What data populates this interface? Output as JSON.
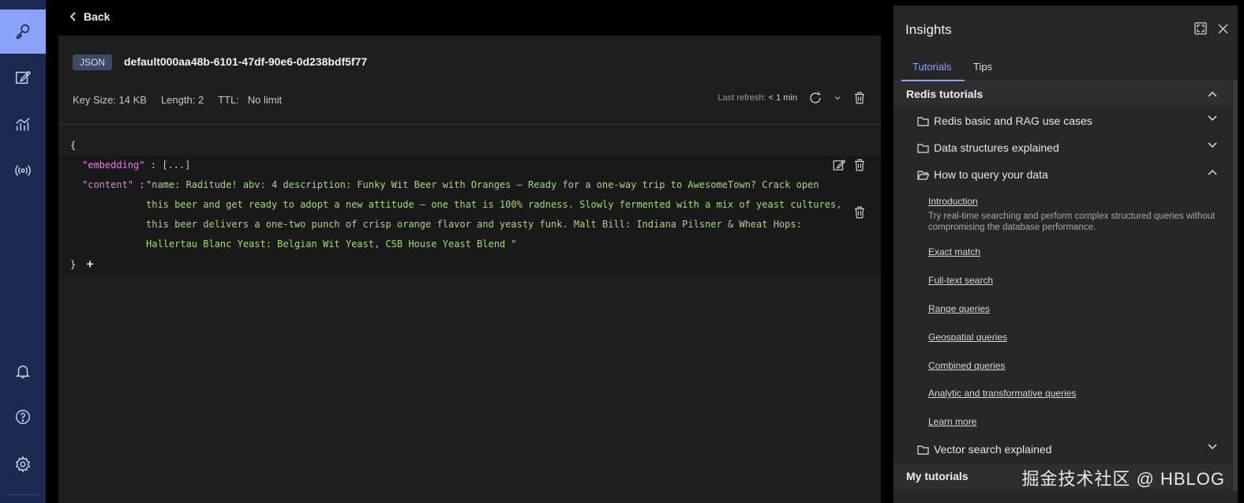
{
  "nav": {
    "items": [
      "browser-icon",
      "workbench-icon",
      "analytics-icon",
      "pubsub-icon"
    ],
    "bottom_items": [
      "notifications-icon",
      "help-icon",
      "settings-icon"
    ]
  },
  "topbar": {
    "back_label": "Back"
  },
  "key": {
    "type_badge": "JSON",
    "name": "default000aa48b-6101-47df-90e6-0d238bdf5f77",
    "key_size": "Key Size: 14 KB",
    "length": "Length: 2",
    "ttl_label": "TTL:",
    "ttl_value": "No limit",
    "last_refresh_label": "Last refresh:",
    "last_refresh_value": "< 1 min"
  },
  "json": {
    "open_brace": "{",
    "close_brace": "}",
    "embedding_key": "\"embedding\"",
    "embedding_value": "[...]",
    "colon": ":",
    "content_key": "\"content\"",
    "content_lines": [
      "\"name: Raditude! abv: 4 description: Funky Wit Beer with Oranges – Ready for a one-way trip to AwesomeTown? Crack open",
      "this beer and get ready to adopt a new attitude – one that is 100% radness. Slowly fermented with a mix of yeast cultures,",
      "this beer delivers a one-two punch of crisp orange flavor and yeasty funk. Malt Bill: Indiana Pilsner & Wheat Hops:",
      "Hallertau Blanc Yeast: Belgian Wit Yeast, CSB House Yeast Blend \""
    ],
    "add_label": "+"
  },
  "insights": {
    "title": "Insights",
    "tabs": [
      "Tutorials",
      "Tips"
    ],
    "redis_tutorials_label": "Redis tutorials",
    "folders": [
      "Redis basic and RAG use cases",
      "Data structures explained",
      "How to query your data",
      "Vector search explained"
    ],
    "intro_link": "Introduction",
    "intro_desc": "Try real-time searching and perform complex structured queries without compromising the database performance.",
    "links": [
      "Exact match",
      "Full-text search",
      "Range queries",
      "Geospatial queries",
      "Combined queries",
      "Analytic and transformative queries",
      "Learn more"
    ],
    "my_tutorials_label": "My tutorials"
  },
  "watermark": "掘金技术社区 @ HBLOG",
  "colors": {
    "accent": "#8ba2f9",
    "nav_bg": "#1c2a52",
    "key_color": "#e67de8",
    "string_color": "#a4d97a"
  }
}
